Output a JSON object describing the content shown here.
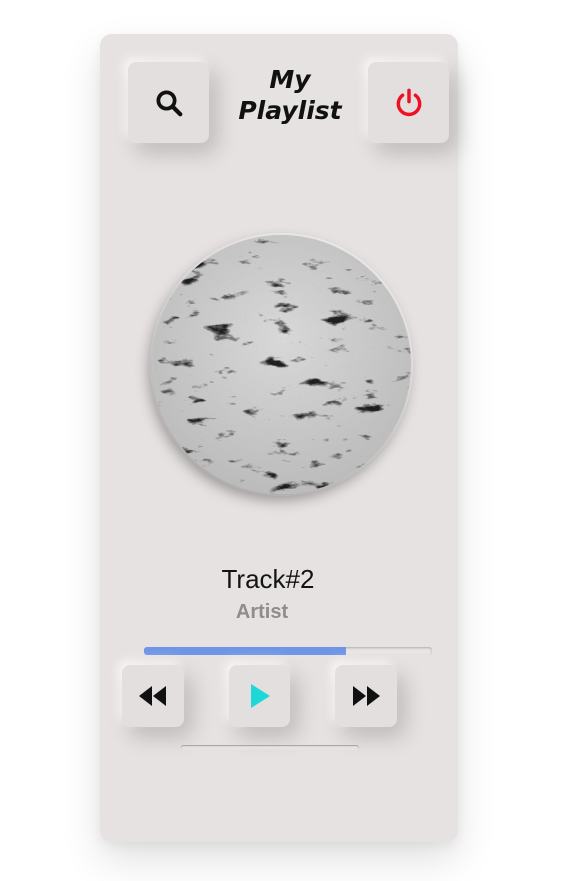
{
  "header": {
    "title_line1": "My",
    "title_line2": "Playlist",
    "search_icon": "search-icon",
    "power_icon": "power-icon"
  },
  "track": {
    "name": "Track#2",
    "artist": "Artist",
    "progress": 0.7
  },
  "controls": {
    "rewind_icon": "rewind-icon",
    "play_icon": "play-icon",
    "forward_icon": "fast-forward-icon"
  },
  "colors": {
    "card_bg": "#e6e2e1",
    "progress_fill": "#6f96e6",
    "play_icon": "#1ed8d8",
    "power_icon": "#ee1122"
  }
}
